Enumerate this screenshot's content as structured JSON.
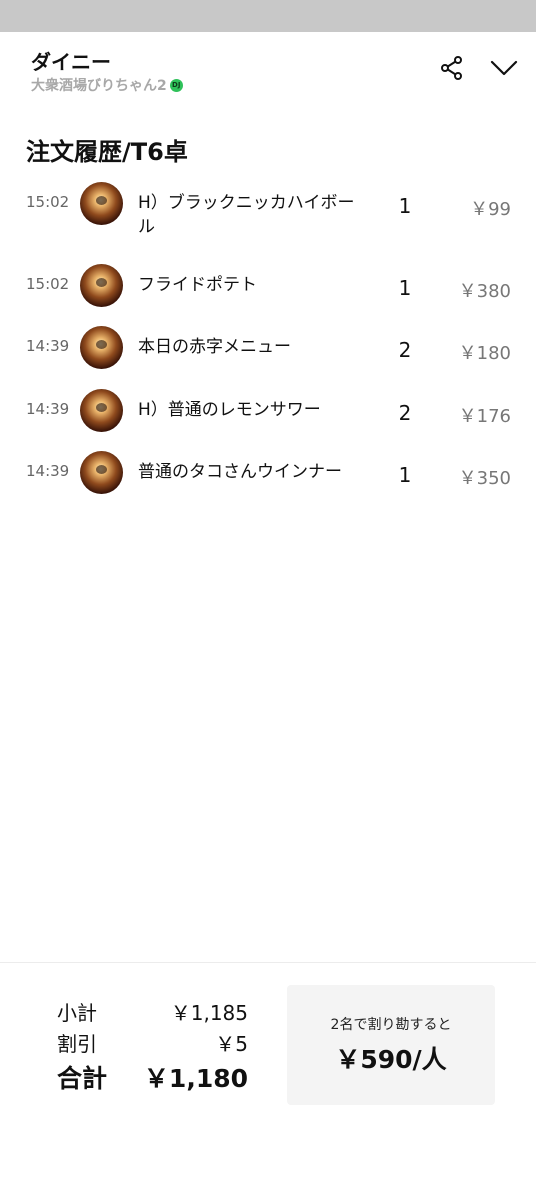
{
  "header": {
    "title": "ダイニー",
    "subtitle": "大衆酒場びりちゃん2",
    "badge_text": "DJ",
    "badge_color": "#2fc15a"
  },
  "section_title": "注文履歴/T6卓",
  "orders": [
    {
      "time": "15:02",
      "name": "H）ブラックニッカハイボール",
      "qty": "1",
      "price": "￥99"
    },
    {
      "time": "15:02",
      "name": "フライドポテト",
      "qty": "1",
      "price": "￥380"
    },
    {
      "time": "14:39",
      "name": "本日の赤字メニュー",
      "qty": "2",
      "price": "￥180"
    },
    {
      "time": "14:39",
      "name": "H）普通のレモンサワー",
      "qty": "2",
      "price": "￥176"
    },
    {
      "time": "14:39",
      "name": "普通のタコさんウインナー",
      "qty": "1",
      "price": "￥350"
    }
  ],
  "summary": {
    "subtotal_label": "小計",
    "subtotal_value": "￥1,185",
    "discount_label": "割引",
    "discount_value": "￥5",
    "total_label": "合計",
    "total_value": "￥1,180"
  },
  "split": {
    "label": "2名で割り勘すると",
    "value": "￥590/人"
  },
  "icons": {
    "share": "share-icon",
    "collapse": "chevron-down-icon",
    "avatar": "food-thumbnail"
  }
}
